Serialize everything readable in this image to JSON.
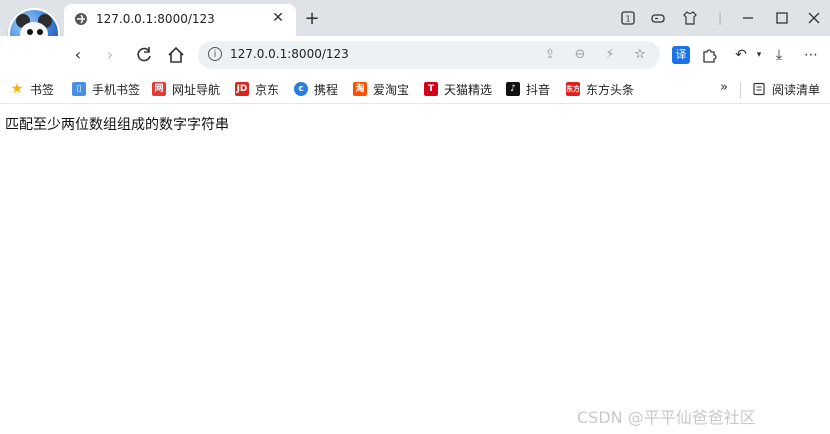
{
  "tab": {
    "title": "127.0.0.1:8000/123"
  },
  "address_bar": {
    "url": "127.0.0.1:8000/123"
  },
  "bookmarks": [
    {
      "label": "书签",
      "icon": "star-icon",
      "color": "#f4b400"
    },
    {
      "label": "手机书签",
      "icon": "phone-icon",
      "color": "#4a90e2"
    },
    {
      "label": "网址导航",
      "icon": "nav-site-icon",
      "color": "#e53935"
    },
    {
      "label": "京东",
      "icon": "jd-icon",
      "color": "#d7261e"
    },
    {
      "label": "携程",
      "icon": "ctrip-icon",
      "color": "#2a7de1"
    },
    {
      "label": "爱淘宝",
      "icon": "taobao-icon",
      "color": "#ff5000"
    },
    {
      "label": "天猫精选",
      "icon": "tmall-icon",
      "color": "#d4001a"
    },
    {
      "label": "抖音",
      "icon": "douyin-icon",
      "color": "#111111"
    },
    {
      "label": "东方头条",
      "icon": "dftt-icon",
      "color": "#e02020"
    }
  ],
  "reading_list": {
    "label": "阅读清单"
  },
  "page": {
    "text": "匹配至少两位数组组成的数字字符串"
  },
  "watermark": {
    "text": "CSDN @平平仙爸爸社区"
  }
}
